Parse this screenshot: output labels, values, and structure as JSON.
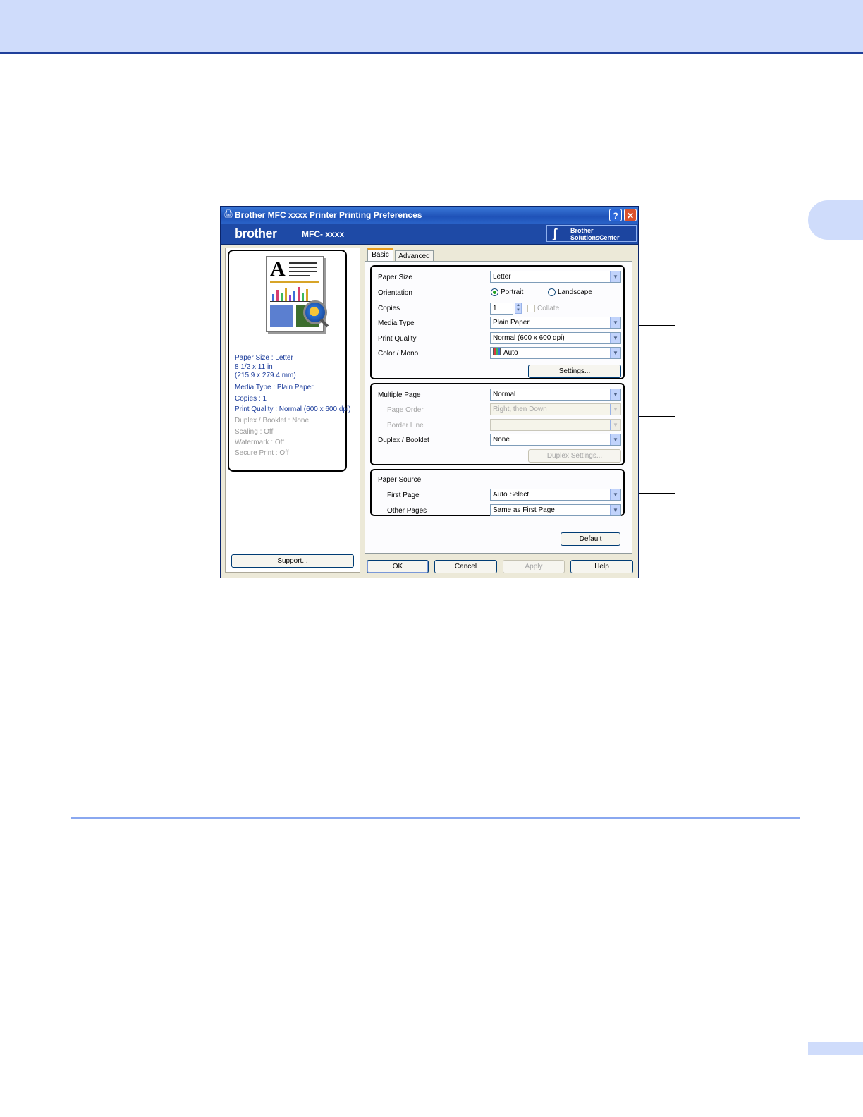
{
  "dialog": {
    "title": "Brother MFC xxxx Printer Printing Preferences",
    "help_label": "?",
    "close_label": "✕",
    "brand": "brother",
    "model": "MFC- xxxx",
    "solutions_line1": "Brother",
    "solutions_line2": "SolutionsCenter"
  },
  "summary": {
    "paper_size": "Paper Size : Letter",
    "paper_dims1": "8 1/2 x 11 in",
    "paper_dims2": "(215.9 x 279.4 mm)",
    "media_type": "Media Type : Plain Paper",
    "copies": "Copies : 1",
    "print_quality": "Print Quality : Normal (600 x 600 dpi)",
    "duplex": "Duplex / Booklet : None",
    "scaling": "Scaling : Off",
    "watermark": "Watermark : Off",
    "secure_print": "Secure Print : Off"
  },
  "support_label": "Support...",
  "tabs": [
    {
      "label": "Basic"
    },
    {
      "label": "Advanced"
    }
  ],
  "basic": {
    "paper_size_label": "Paper Size",
    "paper_size_value": "Letter",
    "orientation_label": "Orientation",
    "portrait_label": "Portrait",
    "landscape_label": "Landscape",
    "copies_label": "Copies",
    "copies_value": "1",
    "collate_label": "Collate",
    "media_type_label": "Media Type",
    "media_type_value": "Plain Paper",
    "print_quality_label": "Print Quality",
    "print_quality_value": "Normal (600 x 600 dpi)",
    "color_label": "Color / Mono",
    "color_value": "Auto",
    "settings_label": "Settings...",
    "multiple_page_label": "Multiple Page",
    "multiple_page_value": "Normal",
    "page_order_label": "Page Order",
    "page_order_value": "Right, then Down",
    "border_line_label": "Border Line",
    "border_line_value": "",
    "duplex_label": "Duplex / Booklet",
    "duplex_value": "None",
    "duplex_settings_label": "Duplex Settings...",
    "paper_source_label": "Paper Source",
    "first_page_label": "First Page",
    "first_page_value": "Auto Select",
    "other_pages_label": "Other Pages",
    "other_pages_value": "Same as First Page",
    "default_label": "Default"
  },
  "footer_buttons": {
    "ok": "OK",
    "cancel": "Cancel",
    "apply": "Apply",
    "help": "Help"
  }
}
